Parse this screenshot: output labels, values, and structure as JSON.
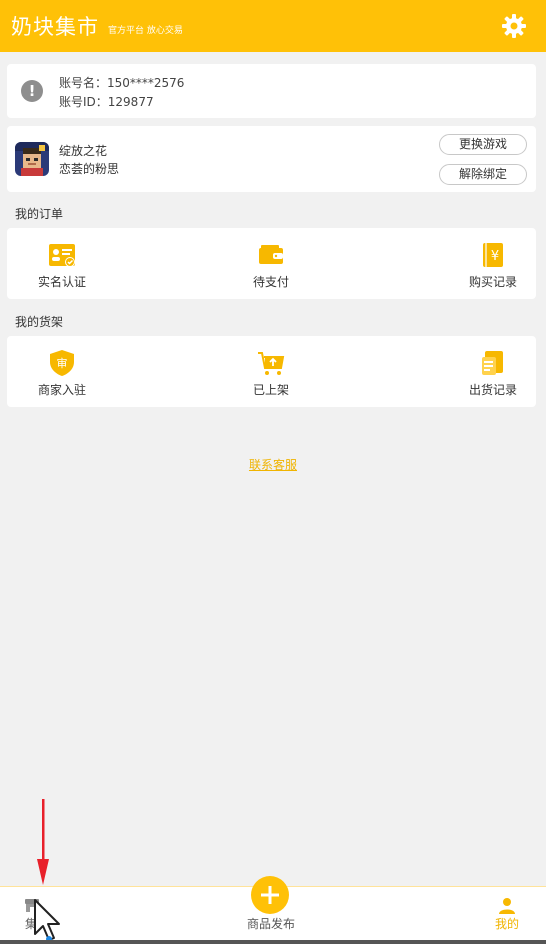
{
  "header": {
    "title": "奶块集市",
    "slogan": "官方平台 放心交易"
  },
  "account": {
    "name_line": "账号名：150****2576",
    "id_line": "账号ID：129877"
  },
  "game": {
    "name": "绽放之花",
    "user": "恋荟的粉思",
    "change_label": "更换游戏",
    "unbind_label": "解除绑定"
  },
  "orders": {
    "title": "我的订单",
    "items": [
      {
        "label": "实名认证",
        "icon": "id-card-icon"
      },
      {
        "label": "待支付",
        "icon": "wallet-icon"
      },
      {
        "label": "购买记录",
        "icon": "receipt-yen-icon"
      }
    ]
  },
  "shelf": {
    "title": "我的货架",
    "items": [
      {
        "label": "商家入驻",
        "icon": "shield-badge-icon"
      },
      {
        "label": "已上架",
        "icon": "cart-upload-icon"
      },
      {
        "label": "出货记录",
        "icon": "shipment-record-icon"
      }
    ]
  },
  "service_link": "联系客服",
  "tabbar": {
    "market_label": "集",
    "publish_label": "商品发布",
    "mine_label": "我的"
  },
  "colors": {
    "accent": "#ffc107",
    "background": "#f1f1f1",
    "link": "#f0b400",
    "annotation_arrow": "#e8202a"
  }
}
